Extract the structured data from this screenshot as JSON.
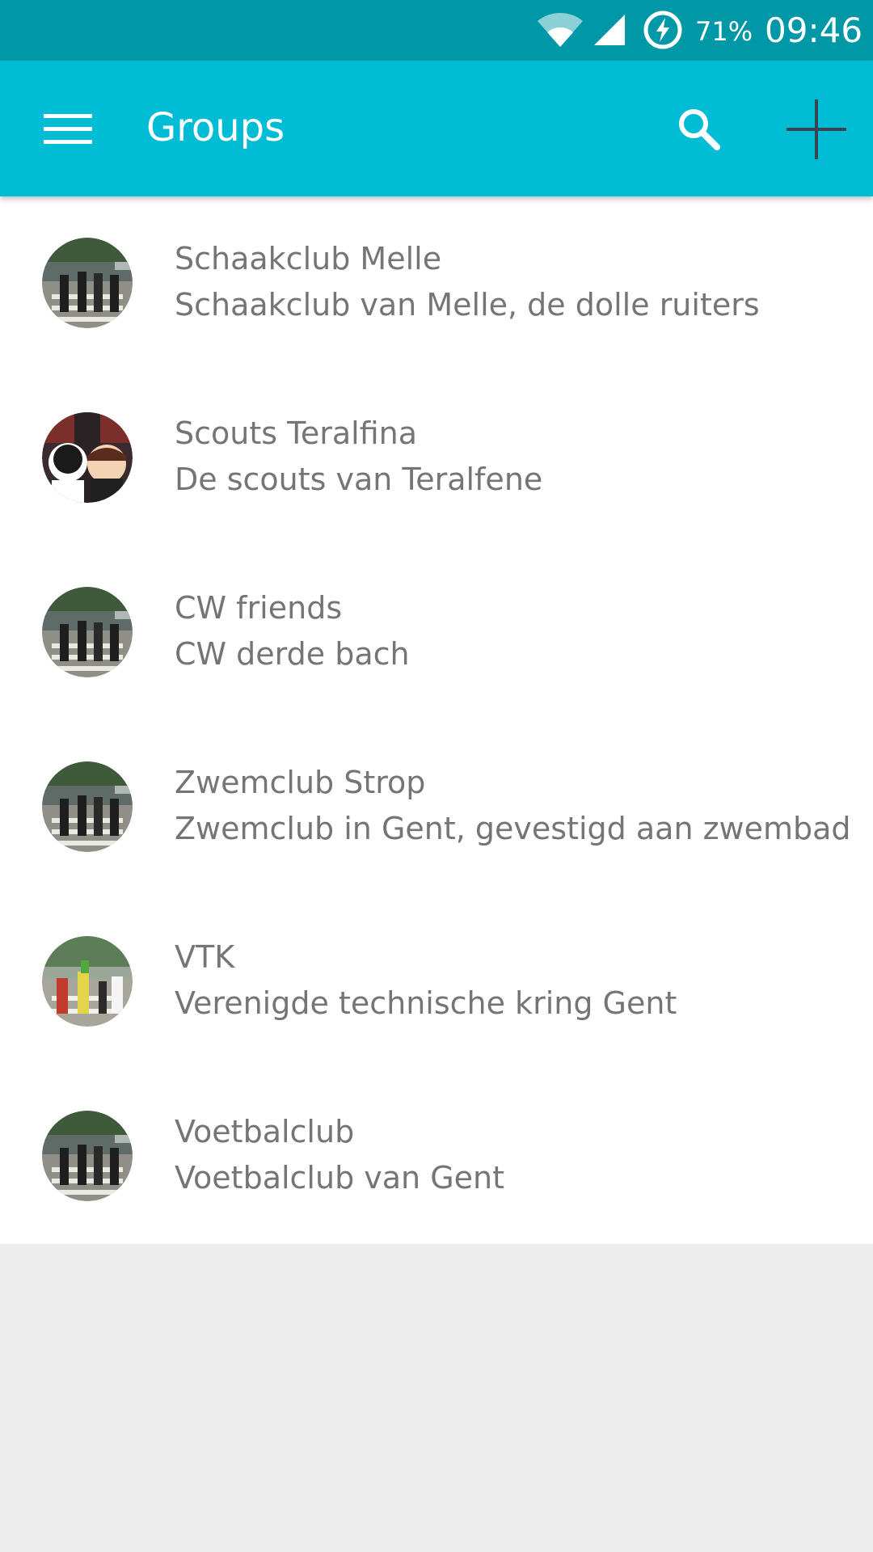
{
  "status_bar": {
    "battery_percent": "71%",
    "time": "09:46",
    "icons": [
      "wifi-icon",
      "signal-icon",
      "battery-saver-icon"
    ]
  },
  "app_bar": {
    "title": "Groups",
    "background_color": "#00bcd4",
    "icons": [
      "menu-icon",
      "search-icon",
      "add-icon"
    ]
  },
  "groups": [
    {
      "name": "Schaakclub Melle",
      "description": "Schaakclub van Melle, de dolle ruiters",
      "avatar": "abbey-road"
    },
    {
      "name": "Scouts Teralfina",
      "description": "De scouts van Teralfene",
      "avatar": "cartoon-characters"
    },
    {
      "name": "CW friends",
      "description": "CW derde bach",
      "avatar": "abbey-road"
    },
    {
      "name": "Zwemclub Strop",
      "description": "Zwemclub in Gent, gevestigd aan zwembad",
      "avatar": "abbey-road"
    },
    {
      "name": "VTK",
      "description": "Verenigde technische kring Gent",
      "avatar": "abbey-road-cartoon"
    },
    {
      "name": "Voetbalclub",
      "description": "Voetbalclub van Gent",
      "avatar": "abbey-road"
    }
  ],
  "colors": {
    "status_bar": "#0097a7",
    "app_bar": "#00bcd4",
    "list_text": "#757575",
    "background": "#ededed"
  }
}
